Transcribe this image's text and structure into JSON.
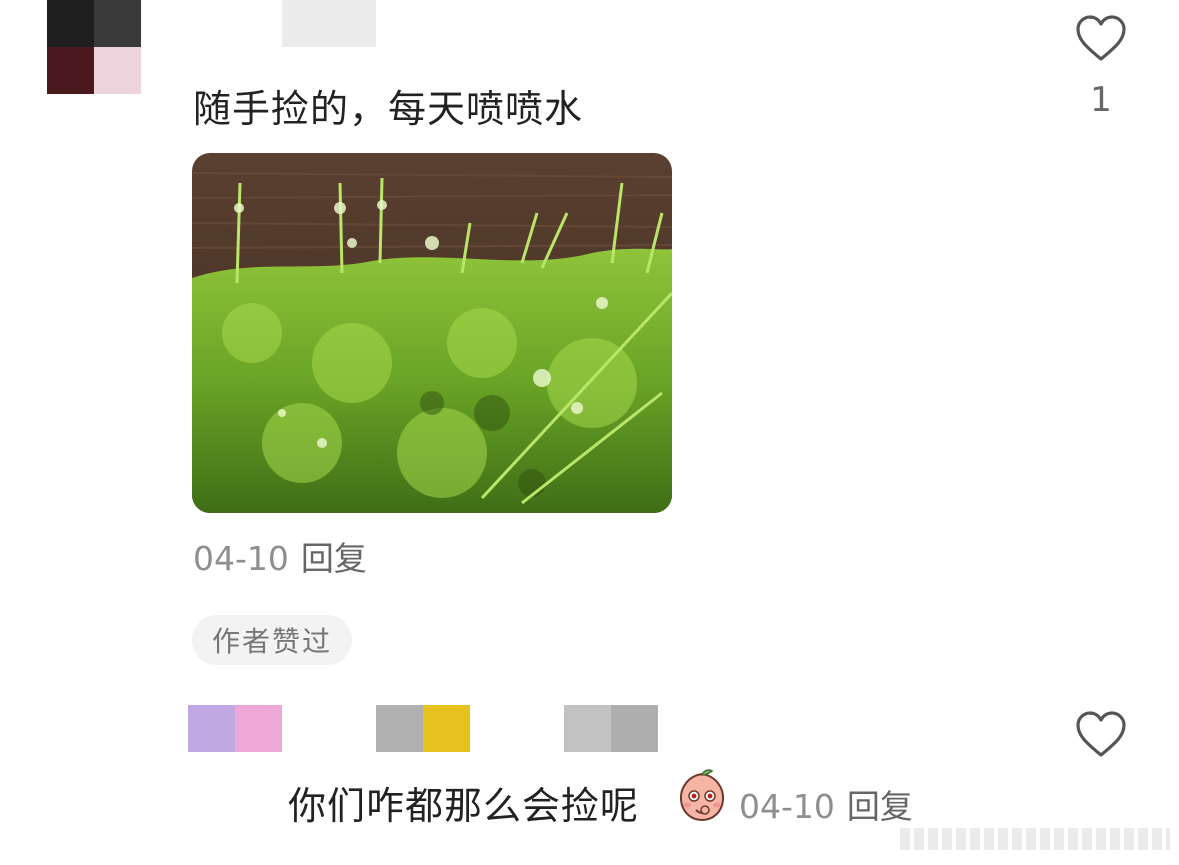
{
  "comment": {
    "avatar_icon": "avatar-pixelated",
    "username_icon": "username-redacted",
    "text": "随手捡的，每天喷喷水",
    "like_count": "1",
    "like_icon": "heart-outline-icon",
    "image_icon": "moss-photo",
    "date": "04-10",
    "reply_label": "回复",
    "author_liked_label": "作者赞过"
  },
  "reply": {
    "text": "你们咋都那么会捡呢",
    "emoji_icon": "peach-shy-emoji",
    "date": "04-10",
    "reply_label": "回复",
    "like_icon": "heart-outline-icon"
  },
  "colors": {
    "text": "#222222",
    "meta": "#8e8e8e",
    "heart": "#555555",
    "pill_bg": "#f3f3f3"
  }
}
